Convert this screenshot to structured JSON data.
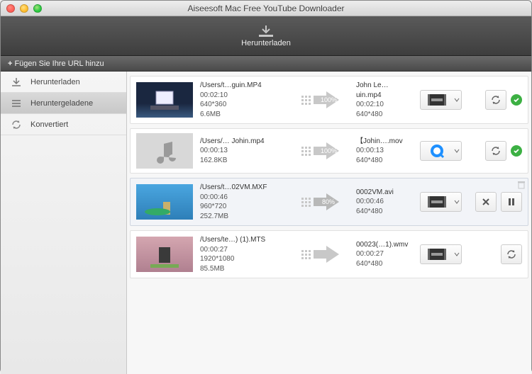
{
  "window": {
    "title": "Aiseesoft Mac Free YouTube Downloader"
  },
  "toolbar": {
    "download_label": "Herunterladen"
  },
  "urlbar": {
    "add_url_label": "Fügen Sie Ihre URL hinzu"
  },
  "sidebar": {
    "items": [
      {
        "label": "Herunterladen"
      },
      {
        "label": "Heruntergeladene"
      },
      {
        "label": "Konvertiert"
      }
    ]
  },
  "items": [
    {
      "src_path": "/Users/t…guin.MP4",
      "src_dur": "00:02:10",
      "src_res": "640*360",
      "src_size": "6.6MB",
      "progress": "100%",
      "dst_name": "John Le…uin.mp4",
      "dst_dur": "00:02:10",
      "dst_res": "640*480",
      "format": "mpeg",
      "status": "done",
      "thumb": "video1"
    },
    {
      "src_path": "/Users/… Johin.mp4",
      "src_dur": "00:00:13",
      "src_size": "162.8KB",
      "progress": "100%",
      "dst_name": "【Johin….mov",
      "dst_dur": "00:00:13",
      "dst_res": "640*480",
      "format": "quicktime",
      "status": "done",
      "thumb": "audio"
    },
    {
      "src_path": "/Users/t…02VM.MXF",
      "src_dur": "00:00:46",
      "src_res": "960*720",
      "src_size": "252.7MB",
      "progress": "80%",
      "dst_name": "0002VM.avi",
      "dst_dur": "00:00:46",
      "dst_res": "640*480",
      "format": "mpeg",
      "status": "running",
      "thumb": "video2",
      "selected": true
    },
    {
      "src_path": "/Users/te…) (1).MTS",
      "src_dur": "00:00:27",
      "src_res": "1920*1080",
      "src_size": "85.5MB",
      "progress": "",
      "dst_name": "00023(…1).wmv",
      "dst_dur": "00:00:27",
      "dst_res": "640*480",
      "format": "wmv",
      "status": "idle",
      "thumb": "video3"
    }
  ]
}
